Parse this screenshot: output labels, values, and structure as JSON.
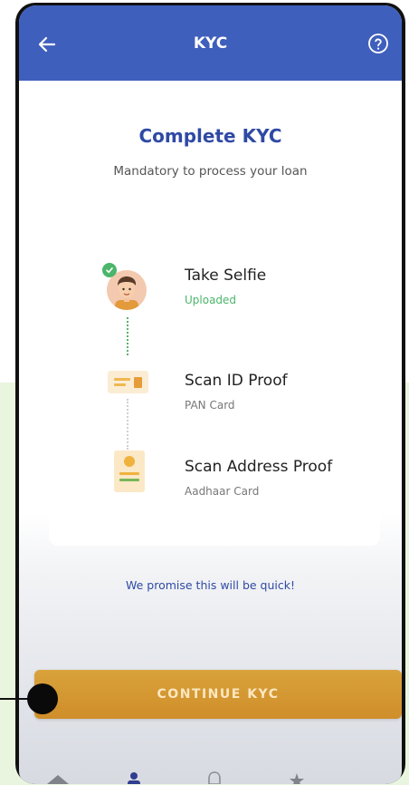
{
  "appbar": {
    "title": "KYC",
    "back_icon": "arrow-left-icon",
    "help_icon": "question-circle-icon",
    "color": "#3f5fbd"
  },
  "main": {
    "heading": "Complete KYC",
    "subheading": "Mandatory to process your loan",
    "steps": [
      {
        "title": "Take Selfie",
        "status": "Uploaded",
        "status_color": "#4bb66a",
        "icon": "selfie-avatar-icon",
        "completed": true
      },
      {
        "title": "Scan ID Proof",
        "status": "PAN Card",
        "status_color": "#777777",
        "icon": "id-card-icon",
        "completed": false
      },
      {
        "title": "Scan Address Proof",
        "status": "Aadhaar Card",
        "status_color": "#777777",
        "icon": "address-document-icon",
        "completed": false
      }
    ],
    "promise": "We promise this will be quick!"
  },
  "cta": {
    "label": "CONTINUE KYC",
    "color": "#d49a33"
  },
  "bottom_nav": {
    "icons": [
      "home-icon",
      "profile-icon",
      "bell-icon",
      "star-icon"
    ]
  }
}
